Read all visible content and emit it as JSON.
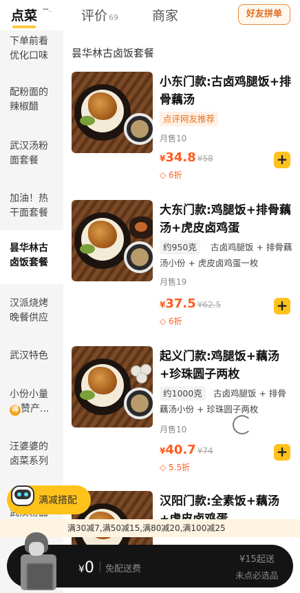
{
  "tabs": {
    "order": "点菜",
    "reviews": "评价",
    "reviews_count": "69",
    "merchant": "商家",
    "group_order": "好友拼单"
  },
  "sidebar": {
    "items": [
      {
        "label": "下单前看优化口味"
      },
      {
        "label": "配粉面的辣椒醋"
      },
      {
        "label": "武汉汤粉面套餐"
      },
      {
        "label": "加油！热干面套餐"
      },
      {
        "label": "昙华林古卤饭套餐"
      },
      {
        "label": "汉派烧烤晚餐供应"
      },
      {
        "label": "武汉特色"
      },
      {
        "label": "小份小量",
        "label2": "赞产...",
        "badge": "得"
      },
      {
        "label": "汪婆婆的卤菜系列"
      },
      {
        "label": "武汉粉面"
      }
    ]
  },
  "section": {
    "title": "昙华林古卤饭套餐"
  },
  "items": [
    {
      "name": "小东门款:古卤鸡腿饭+排骨藕汤",
      "tag": "点评网友推荐",
      "sales": "月售10",
      "currency": "¥",
      "price": "34.8",
      "original_price": "¥58",
      "discount": "6折"
    },
    {
      "name": "大东门款:鸡腿饭+排骨藕汤+虎皮卤鸡蛋",
      "weight": "约950克",
      "desc": "古卤鸡腿饭 + 排骨藕汤小份 + 虎皮卤鸡蛋一枚",
      "sales": "月售19",
      "currency": "¥",
      "price": "37.5",
      "original_price": "¥62.5",
      "discount": "6折"
    },
    {
      "name": "起义门款:鸡腿饭+藕汤+珍珠圆子两枚",
      "weight": "约1000克",
      "desc": "古卤鸡腿饭 + 排骨藕汤小份 + 珍珠圆子两枚",
      "sales": "月售10",
      "currency": "¥",
      "price": "40.7",
      "original_price": "¥74",
      "discount": "5.5折"
    },
    {
      "name": "汉阳门款:全素饭+藕汤+虎皮卤鸡蛋"
    }
  ],
  "promo": {
    "label": "满减搭配"
  },
  "discount_strip": "满30减7,满50减15,满80减20,满100减25",
  "cart": {
    "currency": "¥",
    "amount": "0",
    "delivery": "免配送费",
    "min_order": "¥15起送",
    "must_select": "未点必选品"
  },
  "colors": {
    "accent_yellow": "#ffc21a",
    "price_orange": "#ff5a1f",
    "cart_bar": "#141414"
  }
}
